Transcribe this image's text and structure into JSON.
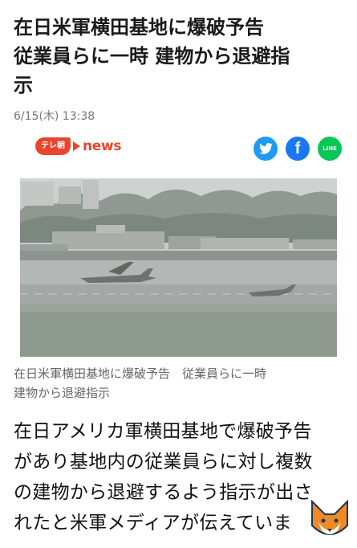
{
  "article": {
    "headline_line1": "在日米軍横田基地に爆破予告",
    "headline_line2": "従業員らに一時 建物から退避指",
    "headline_line3": "示",
    "date": "6/15(木) 13:38",
    "source_badge": "テレ朝",
    "source_name": "news",
    "caption_line1": "在日米軍横田基地に爆破予告　従業員らに一時",
    "caption_line2": "建物から退避指示",
    "body_line1": "在日アメリカ軍横田基地で爆破予告",
    "body_line2": "があり基地内の従業員らに対し複数",
    "body_line3": "の建物から退避するよう指示が出さ",
    "body_line4": "れたと米軍メディアが伝えていま"
  },
  "share": {
    "line_label": "LINE",
    "facebook_label": "f"
  },
  "colors": {
    "accent_red": "#e8452c",
    "twitter": "#1d9bf0",
    "facebook": "#1877f2",
    "line": "#06c755"
  }
}
